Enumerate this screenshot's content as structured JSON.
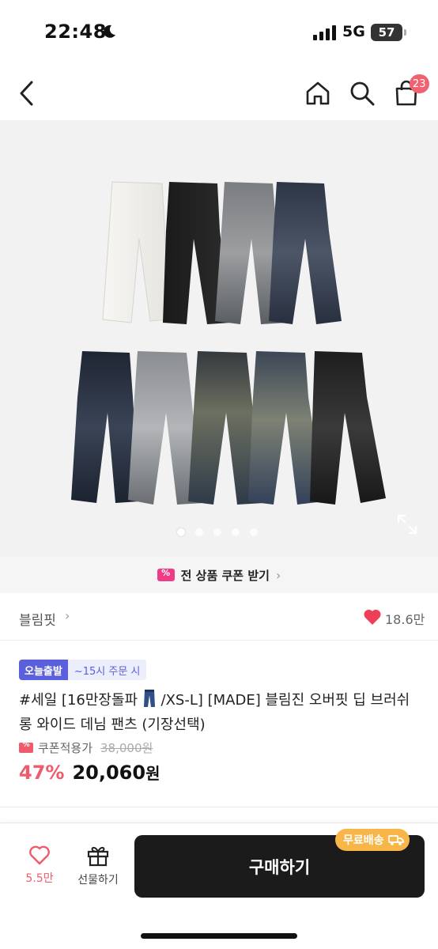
{
  "status_bar": {
    "time": "22:48",
    "network": "5G",
    "battery": "57",
    "icons": [
      "moon-icon",
      "signal-icon",
      "battery-icon"
    ]
  },
  "header": {
    "icons": [
      "back-arrow-icon",
      "home-icon",
      "search-icon",
      "cart-icon"
    ],
    "cart_count": "23"
  },
  "gallery": {
    "slide_count": 5,
    "active_index": 0,
    "icons": [
      "expand-icon"
    ]
  },
  "coupon_strip": {
    "label": "전 상품 쿠폰 받기",
    "chevron": "›"
  },
  "brand": {
    "name": "블림핏",
    "chevron": "›",
    "like_count": "18.6만"
  },
  "product": {
    "tag_primary": "오늘출발",
    "tag_secondary": "~15시 주문 시",
    "title_part1": "#세일 [16만장돌파 ",
    "title_part2": " /XS-L] [MADE] 블림진 오버핏 딥 브러쉬 롱 와이드 데님 팬츠 (기장선택)",
    "coupon_price_label": "쿠폰적용가",
    "original_price": "38,000원",
    "discount": "47%",
    "price": "20,060",
    "price_unit": "원"
  },
  "bottom_bar": {
    "like_count": "5.5만",
    "gift_label": "선물하기",
    "buy_label": "구매하기",
    "free_shipping": "무료배송"
  },
  "colors": {
    "accent_pink": "#ef5b6b",
    "tag_blue": "#5a5fdc",
    "buy_button": "#1b1b1b",
    "free_ship": "#f8b548"
  }
}
